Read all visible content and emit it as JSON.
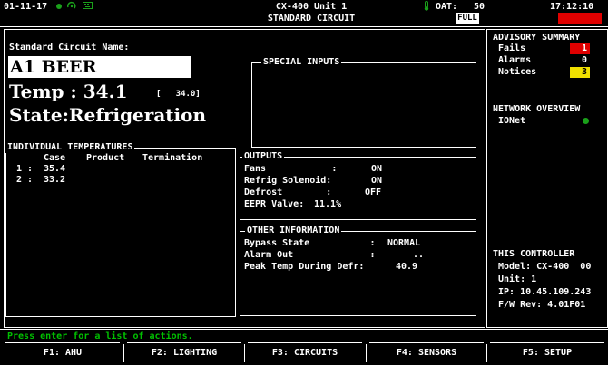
{
  "header": {
    "date": "01-11-17",
    "controller_title": "CX-400 Unit 1",
    "screen_title": "STANDARD CIRCUIT",
    "oat_label": "OAT:",
    "oat_value": "50",
    "full_badge": "FULL",
    "time": "17:12:10",
    "alarm_color": "#e00000"
  },
  "circuit": {
    "name_label": "Standard Circuit Name:",
    "name_value": "A1 BEER",
    "temp_label": "Temp : 34.1",
    "temp_setpoint": "[   34.0]",
    "state": "State:Refrigeration"
  },
  "special_inputs": {
    "title": "SPECIAL INPUTS"
  },
  "individual_temperatures": {
    "title": "INDIVIDUAL TEMPERATURES",
    "headers": [
      "Case",
      "Product",
      "Termination"
    ],
    "rows": [
      {
        "index": "1 :",
        "case": "35.4"
      },
      {
        "index": "2 :",
        "case": "33.2"
      }
    ]
  },
  "outputs": {
    "title": "OUTPUTS",
    "rows": [
      {
        "label": "Fans            :",
        "value": "ON"
      },
      {
        "label": "Refrig Solenoid:",
        "value": "ON"
      },
      {
        "label": "Defrost        :",
        "value": "OFF"
      },
      {
        "label": "EEPR Valve:",
        "value": "11.1%"
      }
    ]
  },
  "other_information": {
    "title": "OTHER INFORMATION",
    "rows": [
      {
        "label": "Bypass State           :",
        "value": "NORMAL"
      },
      {
        "label": "Alarm Out              :",
        "value": ".."
      },
      {
        "label": "Peak Temp During Defr:",
        "value": "40.9"
      }
    ]
  },
  "advisory": {
    "title": "ADVISORY SUMMARY",
    "items": [
      {
        "label": "Fails",
        "count": "1",
        "color": "#e00000",
        "text_color": "#ffffff"
      },
      {
        "label": "Alarms",
        "count": "0",
        "color": "#000000",
        "text_color": "#ffffff"
      },
      {
        "label": "Notices",
        "count": "3",
        "color": "#f0e000",
        "text_color": "#000000"
      }
    ]
  },
  "network": {
    "title": "NETWORK OVERVIEW",
    "items": [
      {
        "label": "IONet",
        "status_color": "#1aa01a"
      }
    ]
  },
  "controller": {
    "title": "THIS CONTROLLER",
    "model": "Model: CX-400  00",
    "unit": "Unit: 1",
    "ip": "IP: 10.45.109.243",
    "fw": "F/W Rev: 4.01F01"
  },
  "status_line": "Press enter for a list of actions.",
  "function_keys": [
    "F1: AHU",
    "F2: LIGHTING",
    "F3: CIRCUITS",
    "F4: SENSORS",
    "F5: SETUP"
  ]
}
